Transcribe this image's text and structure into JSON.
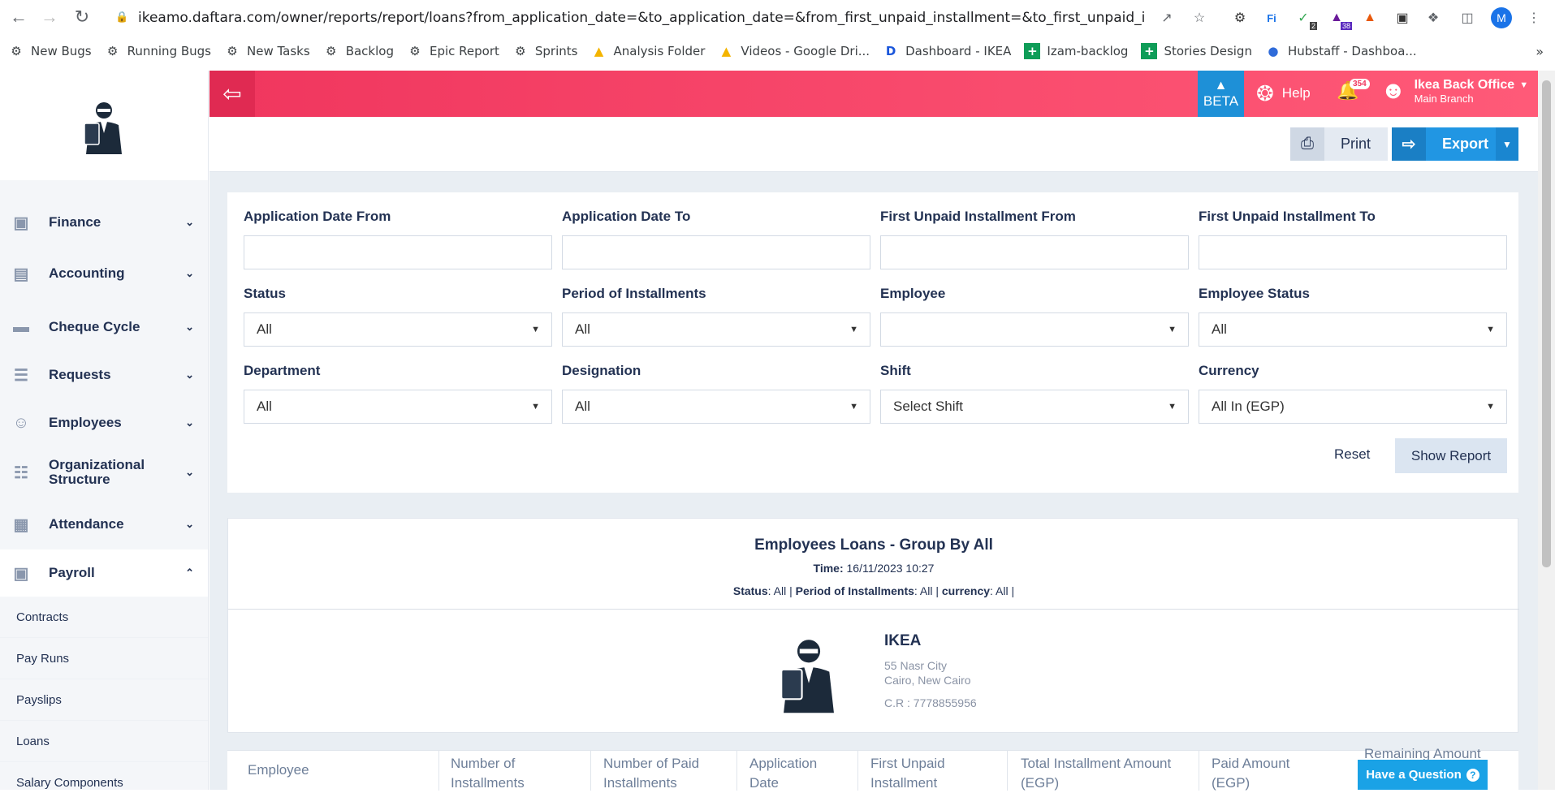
{
  "browser": {
    "url": "ikeamo.daftara.com/owner/reports/report/loans?from_application_date=&to_application_date=&from_first_unpaid_installment=&to_first_unpaid_installment=...",
    "profile_initial": "M",
    "ext_badge_1": "2",
    "ext_badge_2": "38",
    "bookmarks": [
      {
        "label": "New Bugs",
        "icon": "gear-icon"
      },
      {
        "label": "Running Bugs",
        "icon": "gear-icon"
      },
      {
        "label": "New Tasks",
        "icon": "gear-icon"
      },
      {
        "label": "Backlog",
        "icon": "gear-icon"
      },
      {
        "label": "Epic Report",
        "icon": "gear-icon"
      },
      {
        "label": "Sprints",
        "icon": "gear-icon"
      },
      {
        "label": "Analysis Folder",
        "icon": "drive-icon"
      },
      {
        "label": "Videos - Google Dri...",
        "icon": "drive-icon"
      },
      {
        "label": "Dashboard - IKEA",
        "icon": "d-icon"
      },
      {
        "label": "Izam-backlog",
        "icon": "sheets-icon"
      },
      {
        "label": "Stories Design",
        "icon": "sheets-icon"
      },
      {
        "label": "Hubstaff - Dashboa...",
        "icon": "hubstaff-icon"
      }
    ]
  },
  "sidebar": {
    "items": [
      {
        "label": "Finance"
      },
      {
        "label": "Accounting"
      },
      {
        "label": "Cheque Cycle"
      },
      {
        "label": "Requests"
      },
      {
        "label": "Employees"
      },
      {
        "label": "Organizational Structure"
      },
      {
        "label": "Attendance"
      },
      {
        "label": "Payroll"
      }
    ],
    "sub_items": [
      {
        "label": "Contracts"
      },
      {
        "label": "Pay Runs"
      },
      {
        "label": "Payslips"
      },
      {
        "label": "Loans"
      },
      {
        "label": "Salary Components"
      }
    ]
  },
  "topbar": {
    "beta": "BETA",
    "help": "Help",
    "notifications": "354",
    "user_name": "Ikea Back Office",
    "branch": "Main Branch"
  },
  "actions": {
    "print": "Print",
    "export": "Export"
  },
  "filters": {
    "app_date_from": "Application Date From",
    "app_date_to": "Application Date To",
    "first_unpaid_from": "First Unpaid Installment From",
    "first_unpaid_to": "First Unpaid Installment To",
    "status": "Status",
    "status_value": "All",
    "period": "Period of Installments",
    "period_value": "All",
    "employee": "Employee",
    "employee_value": "",
    "employee_status": "Employee Status",
    "employee_status_value": "All",
    "department": "Department",
    "department_value": "All",
    "designation": "Designation",
    "designation_value": "All",
    "shift": "Shift",
    "shift_value": "Select Shift",
    "currency": "Currency",
    "currency_value": "All In (EGP)",
    "reset": "Reset",
    "show_report": "Show Report"
  },
  "report": {
    "title": "Employees Loans - Group By All",
    "time_label": "Time:",
    "time_value": "16/11/2023 10:27",
    "status_label": "Status",
    "status_value": ": All |",
    "period_label": "Period of Installments",
    "period_value": ": All |",
    "currency_label": "currency",
    "currency_value": ": All |",
    "company_name": "IKEA",
    "address1": "55 Nasr City",
    "address2": "Cairo, New Cairo",
    "cr": "C.R : 7778855956"
  },
  "table": {
    "headers": [
      "Employee",
      "Number of Installments",
      "Number of Paid Installments",
      "Application Date",
      "First Unpaid Installment",
      "Total Installment Amount (EGP)",
      "Paid Amount (EGP)",
      "Remaining Amount"
    ]
  },
  "chat": {
    "label": "Have a Question"
  }
}
